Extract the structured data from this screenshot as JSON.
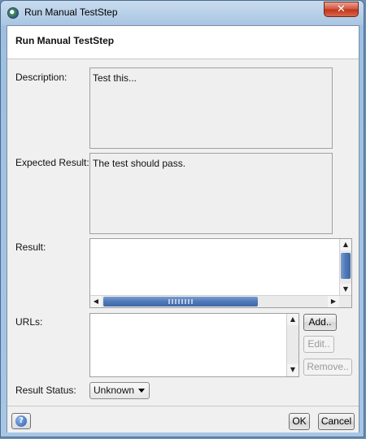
{
  "window": {
    "title": "Run Manual TestStep",
    "close_glyph": "✕"
  },
  "header": {
    "title": "Run Manual TestStep"
  },
  "form": {
    "description_label": "Description:",
    "description_value": "Test this...",
    "expected_label": "Expected Result:",
    "expected_value": "The test should pass.",
    "result_label": "Result:",
    "result_value": "",
    "urls_label": "URLs:",
    "add_label": "Add..",
    "edit_label": "Edit..",
    "remove_label": "Remove..",
    "status_label": "Result Status:",
    "status_value": "Unknown"
  },
  "footer": {
    "help_glyph": "?",
    "ok_label": "OK",
    "cancel_label": "Cancel"
  },
  "icons": {
    "app": "soapui-icon",
    "close": "close-icon",
    "help": "help-icon"
  },
  "colors": {
    "accent": "#4e78b8",
    "title_bar": "#a9c5e3",
    "close_button": "#c03318"
  }
}
